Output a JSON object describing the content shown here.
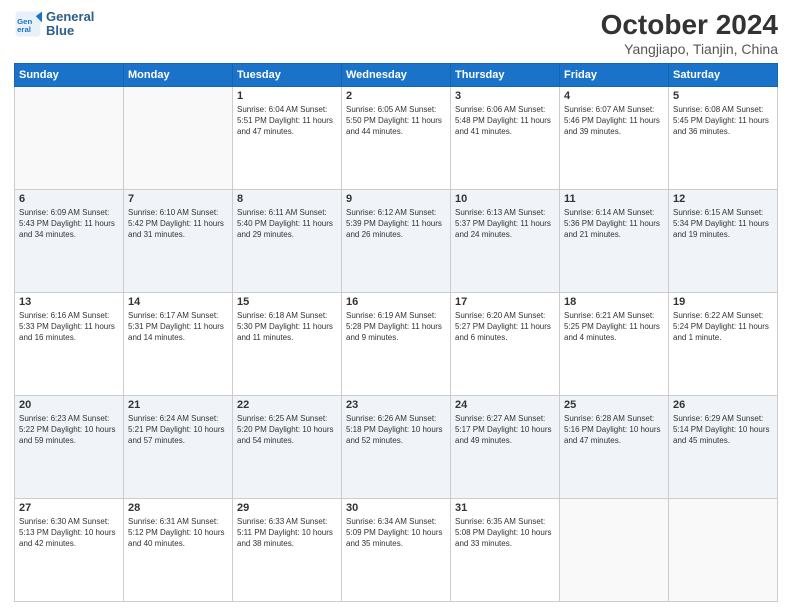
{
  "logo": {
    "line1": "General",
    "line2": "Blue"
  },
  "title": "October 2024",
  "location": "Yangjiapo, Tianjin, China",
  "weekdays": [
    "Sunday",
    "Monday",
    "Tuesday",
    "Wednesday",
    "Thursday",
    "Friday",
    "Saturday"
  ],
  "weeks": [
    [
      {
        "day": "",
        "info": ""
      },
      {
        "day": "",
        "info": ""
      },
      {
        "day": "1",
        "info": "Sunrise: 6:04 AM\nSunset: 5:51 PM\nDaylight: 11 hours and 47 minutes."
      },
      {
        "day": "2",
        "info": "Sunrise: 6:05 AM\nSunset: 5:50 PM\nDaylight: 11 hours and 44 minutes."
      },
      {
        "day": "3",
        "info": "Sunrise: 6:06 AM\nSunset: 5:48 PM\nDaylight: 11 hours and 41 minutes."
      },
      {
        "day": "4",
        "info": "Sunrise: 6:07 AM\nSunset: 5:46 PM\nDaylight: 11 hours and 39 minutes."
      },
      {
        "day": "5",
        "info": "Sunrise: 6:08 AM\nSunset: 5:45 PM\nDaylight: 11 hours and 36 minutes."
      }
    ],
    [
      {
        "day": "6",
        "info": "Sunrise: 6:09 AM\nSunset: 5:43 PM\nDaylight: 11 hours and 34 minutes."
      },
      {
        "day": "7",
        "info": "Sunrise: 6:10 AM\nSunset: 5:42 PM\nDaylight: 11 hours and 31 minutes."
      },
      {
        "day": "8",
        "info": "Sunrise: 6:11 AM\nSunset: 5:40 PM\nDaylight: 11 hours and 29 minutes."
      },
      {
        "day": "9",
        "info": "Sunrise: 6:12 AM\nSunset: 5:39 PM\nDaylight: 11 hours and 26 minutes."
      },
      {
        "day": "10",
        "info": "Sunrise: 6:13 AM\nSunset: 5:37 PM\nDaylight: 11 hours and 24 minutes."
      },
      {
        "day": "11",
        "info": "Sunrise: 6:14 AM\nSunset: 5:36 PM\nDaylight: 11 hours and 21 minutes."
      },
      {
        "day": "12",
        "info": "Sunrise: 6:15 AM\nSunset: 5:34 PM\nDaylight: 11 hours and 19 minutes."
      }
    ],
    [
      {
        "day": "13",
        "info": "Sunrise: 6:16 AM\nSunset: 5:33 PM\nDaylight: 11 hours and 16 minutes."
      },
      {
        "day": "14",
        "info": "Sunrise: 6:17 AM\nSunset: 5:31 PM\nDaylight: 11 hours and 14 minutes."
      },
      {
        "day": "15",
        "info": "Sunrise: 6:18 AM\nSunset: 5:30 PM\nDaylight: 11 hours and 11 minutes."
      },
      {
        "day": "16",
        "info": "Sunrise: 6:19 AM\nSunset: 5:28 PM\nDaylight: 11 hours and 9 minutes."
      },
      {
        "day": "17",
        "info": "Sunrise: 6:20 AM\nSunset: 5:27 PM\nDaylight: 11 hours and 6 minutes."
      },
      {
        "day": "18",
        "info": "Sunrise: 6:21 AM\nSunset: 5:25 PM\nDaylight: 11 hours and 4 minutes."
      },
      {
        "day": "19",
        "info": "Sunrise: 6:22 AM\nSunset: 5:24 PM\nDaylight: 11 hours and 1 minute."
      }
    ],
    [
      {
        "day": "20",
        "info": "Sunrise: 6:23 AM\nSunset: 5:22 PM\nDaylight: 10 hours and 59 minutes."
      },
      {
        "day": "21",
        "info": "Sunrise: 6:24 AM\nSunset: 5:21 PM\nDaylight: 10 hours and 57 minutes."
      },
      {
        "day": "22",
        "info": "Sunrise: 6:25 AM\nSunset: 5:20 PM\nDaylight: 10 hours and 54 minutes."
      },
      {
        "day": "23",
        "info": "Sunrise: 6:26 AM\nSunset: 5:18 PM\nDaylight: 10 hours and 52 minutes."
      },
      {
        "day": "24",
        "info": "Sunrise: 6:27 AM\nSunset: 5:17 PM\nDaylight: 10 hours and 49 minutes."
      },
      {
        "day": "25",
        "info": "Sunrise: 6:28 AM\nSunset: 5:16 PM\nDaylight: 10 hours and 47 minutes."
      },
      {
        "day": "26",
        "info": "Sunrise: 6:29 AM\nSunset: 5:14 PM\nDaylight: 10 hours and 45 minutes."
      }
    ],
    [
      {
        "day": "27",
        "info": "Sunrise: 6:30 AM\nSunset: 5:13 PM\nDaylight: 10 hours and 42 minutes."
      },
      {
        "day": "28",
        "info": "Sunrise: 6:31 AM\nSunset: 5:12 PM\nDaylight: 10 hours and 40 minutes."
      },
      {
        "day": "29",
        "info": "Sunrise: 6:33 AM\nSunset: 5:11 PM\nDaylight: 10 hours and 38 minutes."
      },
      {
        "day": "30",
        "info": "Sunrise: 6:34 AM\nSunset: 5:09 PM\nDaylight: 10 hours and 35 minutes."
      },
      {
        "day": "31",
        "info": "Sunrise: 6:35 AM\nSunset: 5:08 PM\nDaylight: 10 hours and 33 minutes."
      },
      {
        "day": "",
        "info": ""
      },
      {
        "day": "",
        "info": ""
      }
    ]
  ]
}
